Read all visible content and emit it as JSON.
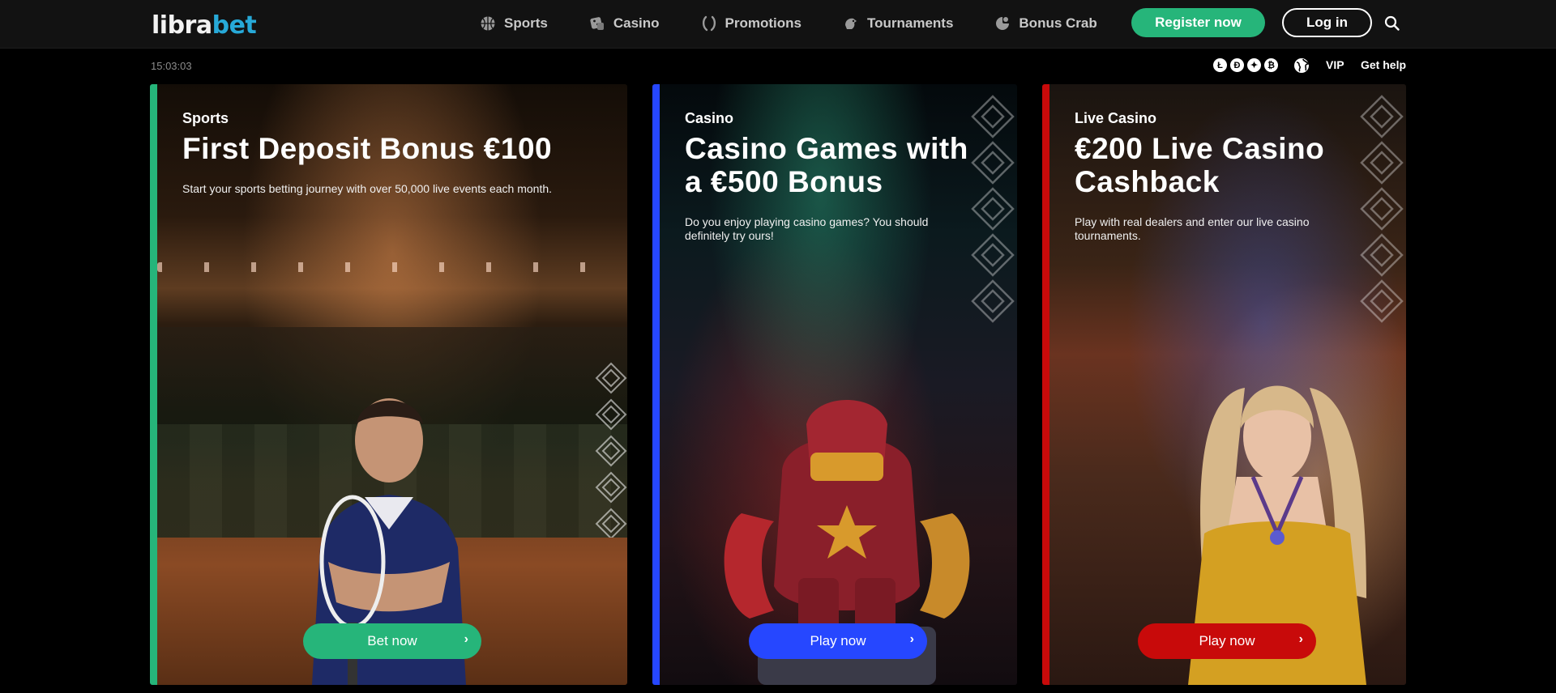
{
  "brand": {
    "logo_part1": "libra",
    "logo_part2": "bet"
  },
  "nav": [
    {
      "label": "Sports",
      "icon": "basketball-icon"
    },
    {
      "label": "Casino",
      "icon": "dice-icon"
    },
    {
      "label": "Promotions",
      "icon": "laurel-icon"
    },
    {
      "label": "Tournaments",
      "icon": "trophy-icon"
    },
    {
      "label": "Bonus Crab",
      "icon": "crab-icon"
    }
  ],
  "header": {
    "register_label": "Register now",
    "login_label": "Log in"
  },
  "subbar": {
    "time": "15:03:03",
    "crypto": [
      "Ł",
      "Ð",
      "✦",
      "₿"
    ],
    "vip_label": "VIP",
    "help_label": "Get help"
  },
  "cards": [
    {
      "kicker": "Sports",
      "title": "First Deposit Bonus €100",
      "description": "Start your sports betting journey with over 50,000 live events each month.",
      "cta": "Bet now",
      "accent": "#26b57a"
    },
    {
      "kicker": "Casino",
      "title": "Casino Games with a €500 Bonus",
      "description": "Do you enjoy playing casino games? You should definitely try ours!",
      "cta": "Play now",
      "accent": "#2647ff"
    },
    {
      "kicker": "Live Casino",
      "title": "€200 Live Casino Cashback",
      "description": "Play with real dealers and enter our live casino tournaments.",
      "cta": "Play now",
      "accent": "#c80a0a"
    }
  ]
}
